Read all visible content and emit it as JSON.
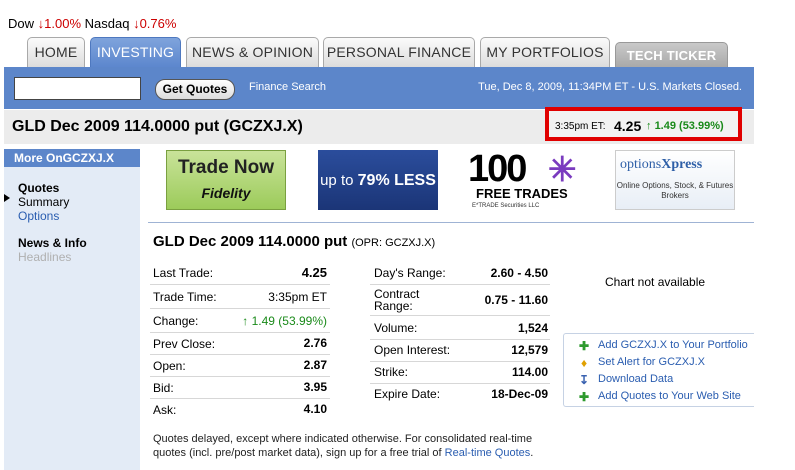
{
  "ticker": {
    "dow_label": "Dow",
    "dow_change": "1.00%",
    "nasdaq_label": "Nasdaq",
    "nasdaq_change": "0.76%",
    "arrow": "🡇"
  },
  "tabs": [
    {
      "label": "HOME"
    },
    {
      "label": "INVESTING"
    },
    {
      "label": "NEWS & OPINION"
    },
    {
      "label": "PERSONAL FINANCE"
    },
    {
      "label": "MY PORTFOLIOS"
    },
    {
      "label": "TECH TICKER"
    }
  ],
  "search": {
    "value": "",
    "button": "Get Quotes",
    "finance_search": "Finance Search",
    "datetime": "Tue, Dec 8, 2009, 11:34PM ET - U.S. Markets Closed."
  },
  "title": {
    "text": "GLD Dec 2009 114.0000 put (GCZXJ.X)",
    "quote_time": "3:35pm ET:",
    "quote_price": "4.25",
    "quote_change": "1.49 (53.99%)",
    "up_arrow": "🡅"
  },
  "leftnav": {
    "header": "More OnGCZXJ.X",
    "quotes": "Quotes",
    "summary": "Summary",
    "options": "Options",
    "news": "News & Info",
    "headlines": "Headlines"
  },
  "ads": {
    "fidelity_line1": "Trade Now",
    "fidelity_line2": "Fidelity",
    "ad79_pre": "up to",
    "ad79_bold": "79% LESS",
    "etrade_big": "100",
    "etrade_free": "FREE TRADES",
    "etrade_sec": "E*TRADE Securities LLC",
    "options_brand_a": "options",
    "options_brand_b": "Xpress",
    "options_sub": "Online Options, Stock, & Futures Brokers"
  },
  "quote": {
    "heading": "GLD Dec 2009 114.0000 put",
    "heading_sub": "(OPR: GCZXJ.X)",
    "left": [
      {
        "label": "Last Trade:",
        "value": "4.25"
      },
      {
        "label": "Trade Time:",
        "value": "3:35pm ET"
      },
      {
        "label": "Change:",
        "value": "1.49 (53.99%)"
      },
      {
        "label": "Prev Close:",
        "value": "2.76"
      },
      {
        "label": "Open:",
        "value": "2.87"
      },
      {
        "label": "Bid:",
        "value": "3.95"
      },
      {
        "label": "Ask:",
        "value": "4.10"
      }
    ],
    "right": [
      {
        "label": "Day's Range:",
        "value": "2.60 - 4.50"
      },
      {
        "label": "Contract",
        "label2": "Range:",
        "value": "0.75 - 11.60"
      },
      {
        "label": "Volume:",
        "value": "1,524"
      },
      {
        "label": "Open Interest:",
        "value": "12,579"
      },
      {
        "label": "Strike:",
        "value": "114.00"
      },
      {
        "label": "Expire Date:",
        "value": "18-Dec-09"
      }
    ]
  },
  "chart_na": "Chart not available",
  "actions": [
    {
      "label": "Add GCZXJ.X to Your Portfolio",
      "icon": "plus-icon"
    },
    {
      "label": "Set Alert for GCZXJ.X",
      "icon": "bell-icon"
    },
    {
      "label": "Download Data",
      "icon": "download-icon"
    },
    {
      "label": "Add Quotes to Your Web Site",
      "icon": "plus-icon"
    }
  ],
  "disclaimer": {
    "text": "Quotes delayed, except where indicated otherwise. For consolidated real-time quotes (incl. pre/post market data), sign up for a free trial of",
    "link": "Real-time Quotes",
    "end": "."
  }
}
